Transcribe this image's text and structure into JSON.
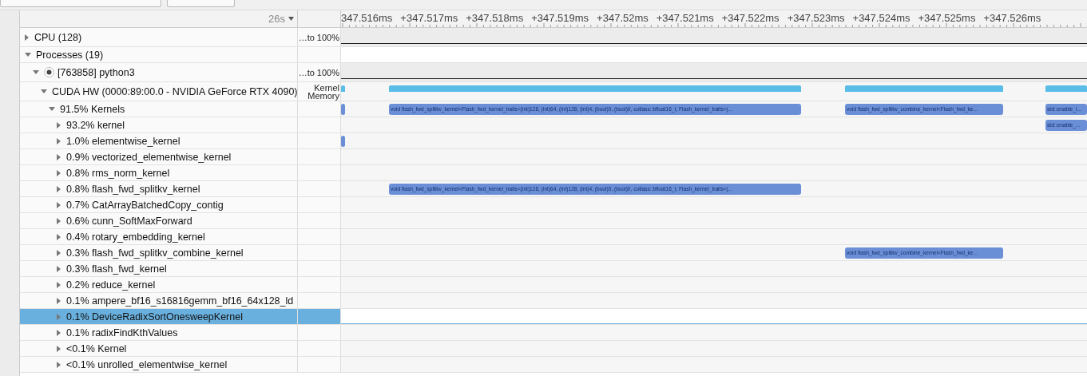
{
  "toolbar": {
    "buttons": [
      {
        "kind": "menu"
      },
      {
        "kind": "gear"
      }
    ]
  },
  "header": {
    "range": "26s",
    "ticks": [
      "347.516ms",
      "+347.517ms",
      "+347.518ms",
      "+347.519ms",
      "+347.52ms",
      "+347.521ms",
      "+347.522ms",
      "+347.523ms",
      "+347.524ms",
      "+347.525ms",
      "+347.526ms"
    ]
  },
  "tree": [
    {
      "kind": "cpu",
      "label": "CPU (128)",
      "expanded": false,
      "selected": false,
      "scale": [
        "…to 100%"
      ]
    },
    {
      "kind": "group",
      "label": "Processes (19)",
      "expanded": true,
      "selected": false,
      "children": [
        {
          "kind": "process",
          "label": "[763858] python3",
          "expanded": true,
          "selected": false,
          "scale": [
            "…to 100%"
          ],
          "children": [
            {
              "kind": "device",
              "label": "CUDA HW (0000:89:00.0 - NVIDIA GeForce RTX 4090)",
              "expanded": true,
              "selected": false,
              "scale": [
                "Kernel",
                "Memory"
              ],
              "events": [
                {
                  "kind": "memory-start"
                },
                {
                  "kind": "memory-splitkv"
                },
                {
                  "kind": "memory-combine"
                },
                {
                  "kind": "memory-enable"
                }
              ],
              "children": [
                {
                  "kind": "kernel",
                  "label": "91.5% Kernels",
                  "expanded": true,
                  "selected": false,
                  "events": [
                    {
                      "kind": "kernel-start"
                    },
                    {
                      "kind": "kernel-splitkv",
                      "label": "void flash_fwd_splitkv_kernel<Flash_fwd_kernel_traits<(int)128, (int)64, (int)128, (int)4, (bool)0, (bool)0, cutlass::bfloat16_t, Flash_kernel_traits<(..."
                    },
                    {
                      "kind": "kernel-combine",
                      "label": "void flash_fwd_splitkv_combine_kernel<Flash_fwd_ke..."
                    },
                    {
                      "kind": "kernel-enable",
                      "label": "std::enable_i..."
                    }
                  ],
                  "children": [
                    {
                      "kind": "kernel",
                      "label": "93.2% kernel",
                      "expanded": false,
                      "selected": false,
                      "events": [
                        {
                          "kind": "kernel-enable",
                          "label": "std::enable_..."
                        }
                      ]
                    },
                    {
                      "kind": "kernel",
                      "label": "1.0% elementwise_kernel",
                      "expanded": false,
                      "selected": false,
                      "events": [
                        {
                          "kind": "kernel-start"
                        }
                      ]
                    },
                    {
                      "kind": "kernel",
                      "label": "0.9% vectorized_elementwise_kernel",
                      "expanded": false,
                      "selected": false
                    },
                    {
                      "kind": "kernel",
                      "label": "0.8% rms_norm_kernel",
                      "expanded": false,
                      "selected": false
                    },
                    {
                      "kind": "kernel",
                      "label": "0.8% flash_fwd_splitkv_kernel",
                      "expanded": false,
                      "selected": false,
                      "events": [
                        {
                          "kind": "kernel-splitkv",
                          "label": "void flash_fwd_splitkv_kernel<Flash_fwd_kernel_traits<(int)128, (int)64, (int)128, (int)4, (bool)0, (bool)0, cutlass::bfloat16_t, Flash_kernel_traits<(..."
                        }
                      ]
                    },
                    {
                      "kind": "kernel",
                      "label": "0.7% CatArrayBatchedCopy_contig",
                      "expanded": false,
                      "selected": false
                    },
                    {
                      "kind": "kernel",
                      "label": "0.6% cunn_SoftMaxForward",
                      "expanded": false,
                      "selected": false
                    },
                    {
                      "kind": "kernel",
                      "label": "0.4% rotary_embedding_kernel",
                      "expanded": false,
                      "selected": false
                    },
                    {
                      "kind": "kernel",
                      "label": "0.3% flash_fwd_splitkv_combine_kernel",
                      "expanded": false,
                      "selected": false,
                      "events": [
                        {
                          "kind": "kernel-combine",
                          "label": "void flash_fwd_splitkv_combine_kernel<Flash_fwd_ke..."
                        }
                      ]
                    },
                    {
                      "kind": "kernel",
                      "label": "0.3% flash_fwd_kernel",
                      "expanded": false,
                      "selected": false
                    },
                    {
                      "kind": "kernel",
                      "label": "0.2% reduce_kernel",
                      "expanded": false,
                      "selected": false
                    },
                    {
                      "kind": "kernel",
                      "label": "0.1% ampere_bf16_s16816gemm_bf16_64x128_ld",
                      "expanded": false,
                      "selected": false
                    },
                    {
                      "kind": "kernel",
                      "label": "0.1% DeviceRadixSortOnesweepKernel",
                      "expanded": false,
                      "selected": true
                    },
                    {
                      "kind": "kernel",
                      "label": "0.1% radixFindKthValues",
                      "expanded": false,
                      "selected": false
                    },
                    {
                      "kind": "kernel",
                      "label": "<0.1% Kernel",
                      "expanded": false,
                      "selected": false
                    },
                    {
                      "kind": "kernel",
                      "label": "<0.1% unrolled_elementwise_kernel",
                      "expanded": false,
                      "selected": false
                    }
                  ]
                }
              ]
            }
          ]
        }
      ]
    }
  ]
}
